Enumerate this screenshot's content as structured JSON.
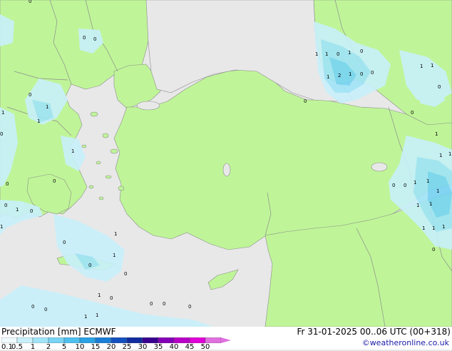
{
  "legend": {
    "title": "Precipitation [mm]",
    "model": "ECMWF",
    "datetime": "Fr 31-01-2025 00..06 UTC (00+318)",
    "credit": "©weatheronline.co.uk",
    "scale_labels": [
      "0.1",
      "0.5",
      "1",
      "2",
      "5",
      "10",
      "15",
      "20",
      "25",
      "30",
      "35",
      "40",
      "45",
      "50"
    ],
    "scale_colors": [
      "#f0fbff",
      "#c8f0fb",
      "#a0e4f8",
      "#78d4f4",
      "#4ec0ee",
      "#2aa2e4",
      "#1a7ed8",
      "#1450c0",
      "#102ca0",
      "#3a0090",
      "#8400b8",
      "#b800c8",
      "#e000d8",
      "#e070e0"
    ]
  },
  "colors": {
    "sea": "#e8e8e8",
    "land": "#bff598",
    "border": "#8c8c8c",
    "precip_light": "#c8f0fb",
    "precip_mid": "#a0e4f8",
    "precip_strong": "#78d4f4"
  },
  "map_labels": [
    "0",
    "1",
    "2"
  ]
}
